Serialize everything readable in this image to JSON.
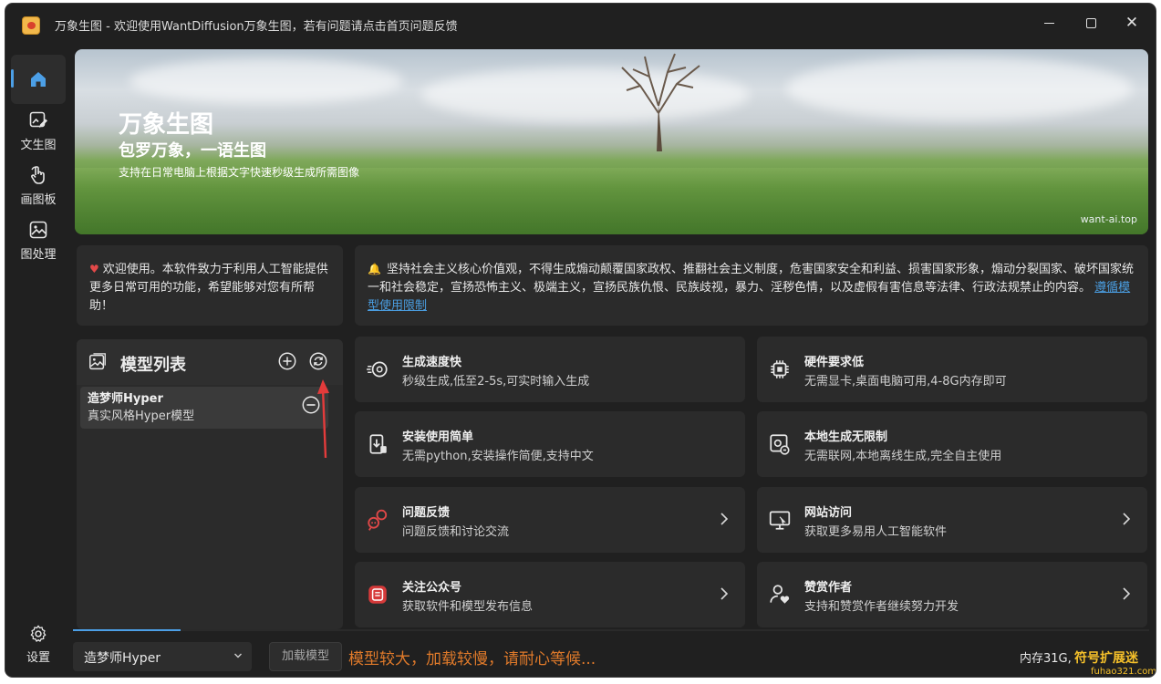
{
  "window": {
    "title": "万象生图 - 欢迎使用WantDiffusion万象生图，若有问题请点击首页问题反馈"
  },
  "sidebar": {
    "items": [
      {
        "label": "",
        "icon": "home-icon"
      },
      {
        "label": "文生图",
        "icon": "edit-image-icon"
      },
      {
        "label": "画图板",
        "icon": "draw-hand-icon"
      },
      {
        "label": "图处理",
        "icon": "image-process-icon"
      }
    ],
    "settings_label": "设置"
  },
  "banner": {
    "title": "万象生图",
    "subtitle": "包罗万象，一语生图",
    "description": "支持在日常电脑上根据文字快速秒级生成所需图像",
    "url": "want-ai.top"
  },
  "notices": {
    "left": "欢迎使用。本软件致力于利用人工智能提供更多日常可用的功能，希望能够对您有所帮助！",
    "right": "坚持社会主义核心价值观，不得生成煽动颠覆国家政权、推翻社会主义制度，危害国家安全和利益、损害国家形象，煽动分裂国家、破坏国家统一和社会稳定，宣扬恐怖主义、极端主义，宣扬民族仇恨、民族歧视，暴力、淫秽色情，以及虚假有害信息等法律、行政法规禁止的内容。",
    "right_link": "遵循模型使用限制"
  },
  "model_list": {
    "title": "模型列表",
    "models": [
      {
        "name": "造梦师Hyper",
        "description": "真实风格Hyper模型"
      }
    ]
  },
  "features": [
    {
      "title": "生成速度快",
      "description": "秒级生成,低至2-5s,可实时输入生成",
      "icon": "speed-icon",
      "link": false
    },
    {
      "title": "硬件要求低",
      "description": "无需显卡,桌面电脑可用,4-8G内存即可",
      "icon": "chip-icon",
      "link": false
    },
    {
      "title": "安装使用简单",
      "description": "无需python,安装操作简便,支持中文",
      "icon": "install-icon",
      "link": false
    },
    {
      "title": "本地生成无限制",
      "description": "无需联网,本地离线生成,完全自主使用",
      "icon": "local-icon",
      "link": false
    },
    {
      "title": "问题反馈",
      "description": "问题反馈和讨论交流",
      "icon": "feedback-icon",
      "link": true
    },
    {
      "title": "网站访问",
      "description": "获取更多易用人工智能软件",
      "icon": "website-icon",
      "link": true
    },
    {
      "title": "关注公众号",
      "description": "获取软件和模型发布信息",
      "icon": "wechat-icon",
      "link": true
    },
    {
      "title": "赞赏作者",
      "description": "支持和赞赏作者继续努力开发",
      "icon": "donate-icon",
      "link": true
    }
  ],
  "bottom": {
    "selected_model": "造梦师Hyper",
    "load_button": "加载模型",
    "status_message": "模型较大，加载较慢，请耐心等候...",
    "memory": "内存31G,",
    "progress": 0.1
  },
  "watermark": {
    "text1": "符号扩展迷",
    "text2": "fuhao321.com"
  },
  "colors": {
    "accent": "#4c9fe6",
    "warning": "#e07a2a",
    "alert": "#e34949",
    "background": "#202020",
    "card": "#2b2b2b"
  }
}
